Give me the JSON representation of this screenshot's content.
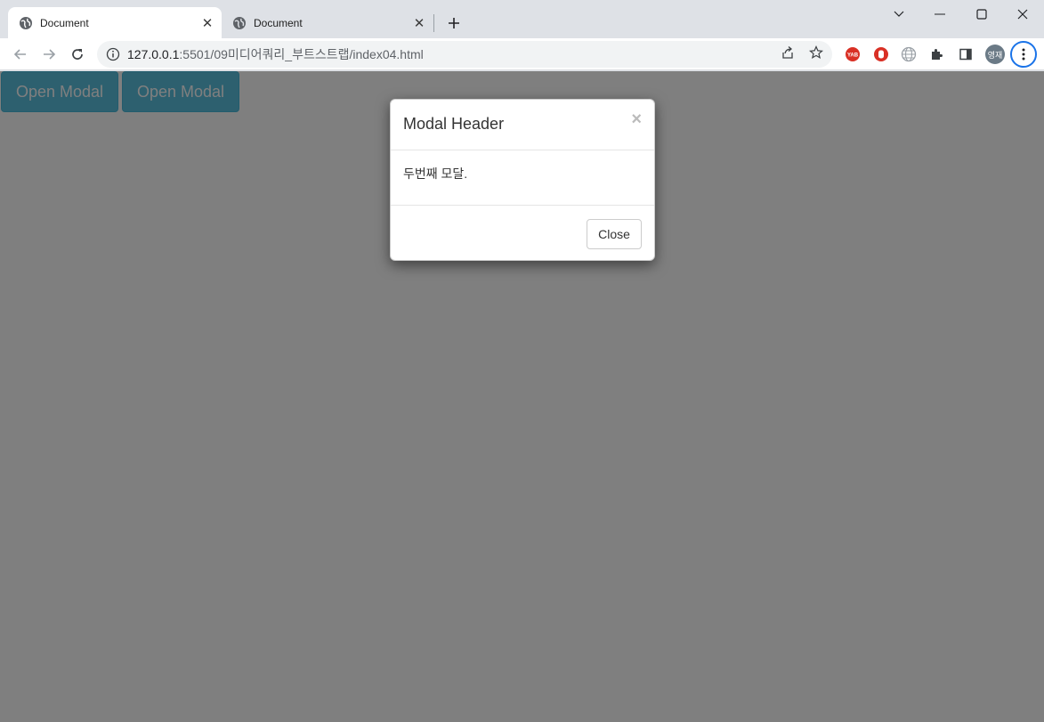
{
  "browser": {
    "tabs": [
      {
        "title": "Document",
        "active": true
      },
      {
        "title": "Document",
        "active": false
      }
    ],
    "url_host": "127.0.0.1",
    "url_path": ":5501/09미디어쿼리_부트스트랩/index04.html",
    "profile_initials": "영재"
  },
  "page": {
    "buttons": [
      {
        "label": "Open Modal"
      },
      {
        "label": "Open Modal"
      }
    ],
    "accent_color": "#5bc0de"
  },
  "modal": {
    "title": "Modal Header",
    "close_symbol": "×",
    "body_text": "두번째 모달.",
    "footer_close_label": "Close"
  },
  "icons": {
    "tab_favicon": "globe-icon",
    "tab_close": "close-icon",
    "new_tab": "plus-icon",
    "back": "arrow-left-icon",
    "forward": "arrow-right-icon",
    "reload": "reload-icon",
    "site_info": "info-icon",
    "share": "share-icon",
    "bookmark": "star-icon",
    "extensions": "puzzle-icon",
    "side_panel": "side-panel-icon",
    "menu": "kebab-menu-icon"
  }
}
